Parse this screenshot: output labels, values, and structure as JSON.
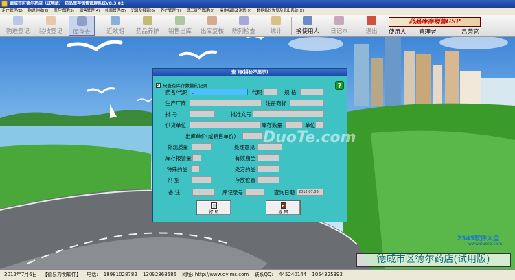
{
  "window": {
    "title": "德威市区德尔药店（试用版）  药品库存销售管理系统V8.3.02"
  },
  "menubar": {
    "items": [
      "用户管理(1)",
      "购进验收(2)",
      "库存管理(3)",
      "销售管理(4)",
      "帐目管理(5)",
      "记录及报表(6)",
      "养护管理(7)",
      "员工资产管理(8)",
      "操作指南及注意(9)",
      "数据备份恢复及退出系统(X)"
    ]
  },
  "toolbar": {
    "buttons": [
      {
        "label": "购进登记",
        "icon": "purchase-register-icon"
      },
      {
        "label": "验收登记",
        "icon": "acceptance-register-icon"
      },
      {
        "label": "库存查",
        "icon": "stock-query-icon"
      },
      {
        "label": "近效期",
        "icon": "expiry-icon"
      },
      {
        "label": "药品养护",
        "icon": "drug-care-icon"
      },
      {
        "label": "销售出库",
        "icon": "sales-out-icon"
      },
      {
        "label": "出库复核",
        "icon": "out-review-icon"
      },
      {
        "label": "陈列检查",
        "icon": "display-check-icon"
      },
      {
        "label": "统计",
        "icon": "statistics-icon"
      },
      {
        "label": "换使用人",
        "icon": "switch-user-icon"
      },
      {
        "label": "日记本",
        "icon": "diary-icon"
      },
      {
        "label": "退出",
        "icon": "exit-icon"
      }
    ],
    "brand_text": "药品库存销售GSP",
    "user_label": "使用人",
    "role": "管理者",
    "user_name": "吕荣亮"
  },
  "dialog": {
    "title": "查  询(拼价不显示)",
    "only_stock_label": "只查有库存数量的记录",
    "fields": {
      "drug_name_code": "药名/代码",
      "code": "代码",
      "spec": "规  格",
      "manufacturer": "生产厂商",
      "trademark": "注册商标",
      "batch_no": "批    号",
      "approval_no": "批准文号",
      "supplier": "供货单位",
      "stock_qty": "库存数量",
      "unit": "单位",
      "out_price": "出库单价(或销售单价)",
      "appearance": "外观质量",
      "handling": "处理意见",
      "stock_alert": "库存报警量",
      "valid_until": "有效期至",
      "special_drug": "特殊药品",
      "prescription": "处方药品",
      "dosage_form": "剂    型",
      "location": "存放位置",
      "remark": "备    注",
      "record_no": "库记录号",
      "query_date": "查询日期"
    },
    "query_date_value": "2012.07.06",
    "cursor_value": "_",
    "buttons": {
      "print": "打 印",
      "exit": "返 回"
    }
  },
  "statusbar": {
    "date": "2012年7月6日",
    "company": "【德易力明软件】",
    "phone_label": "电话:",
    "phone1": "18981028782",
    "phone2": "13092868586",
    "web_label": "网址: http://www.dylms.com",
    "qq_label": "联系QQ:",
    "qq1": "445240144",
    "qq2": "1054325393"
  },
  "watermark": {
    "shop_name": "德威市区德尔药店(试用版)",
    "site": "DuoTe.com",
    "site_2345": "2345软件大全",
    "site_2345_url": "www.DuoTe.com"
  }
}
